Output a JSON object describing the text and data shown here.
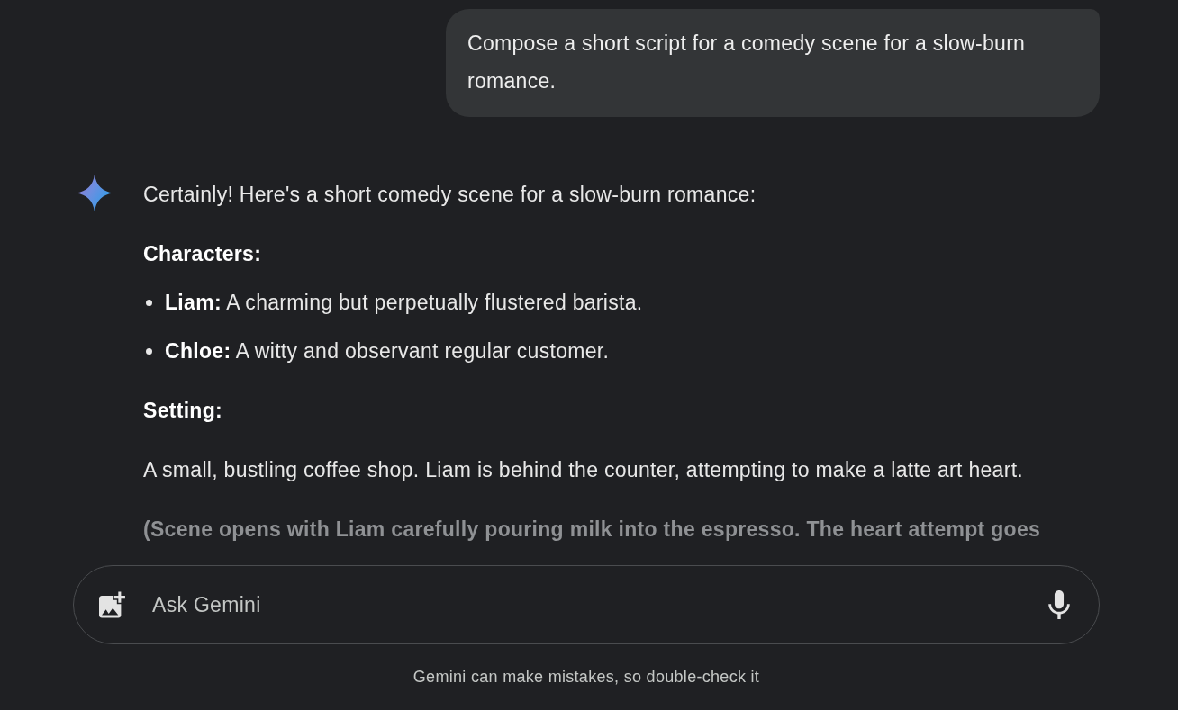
{
  "user_message": {
    "text": "Compose a short script for a comedy scene for a slow-burn romance."
  },
  "response": {
    "blocks": [
      {
        "kind": "paragraph",
        "text": "Certainly! Here's a short comedy scene for a slow-burn romance:"
      },
      {
        "kind": "heading",
        "text": "Characters:"
      },
      {
        "kind": "bullets",
        "items": [
          "**Liam:** A charming but perpetually flustered barista.",
          "**Chloe:** A witty and observant regular customer."
        ]
      },
      {
        "kind": "heading",
        "text": "Setting:"
      },
      {
        "kind": "paragraph",
        "text": "A small, bustling coffee shop. Liam is behind the counter, attempting to make a latte art heart."
      },
      {
        "kind": "stage_direction",
        "text": "(Scene opens with Liam carefully pouring milk into the espresso. The heart attempt goes"
      }
    ]
  },
  "input": {
    "placeholder": "Ask Gemini"
  },
  "disclaimer": "Gemini can make mistakes, so double-check it"
}
